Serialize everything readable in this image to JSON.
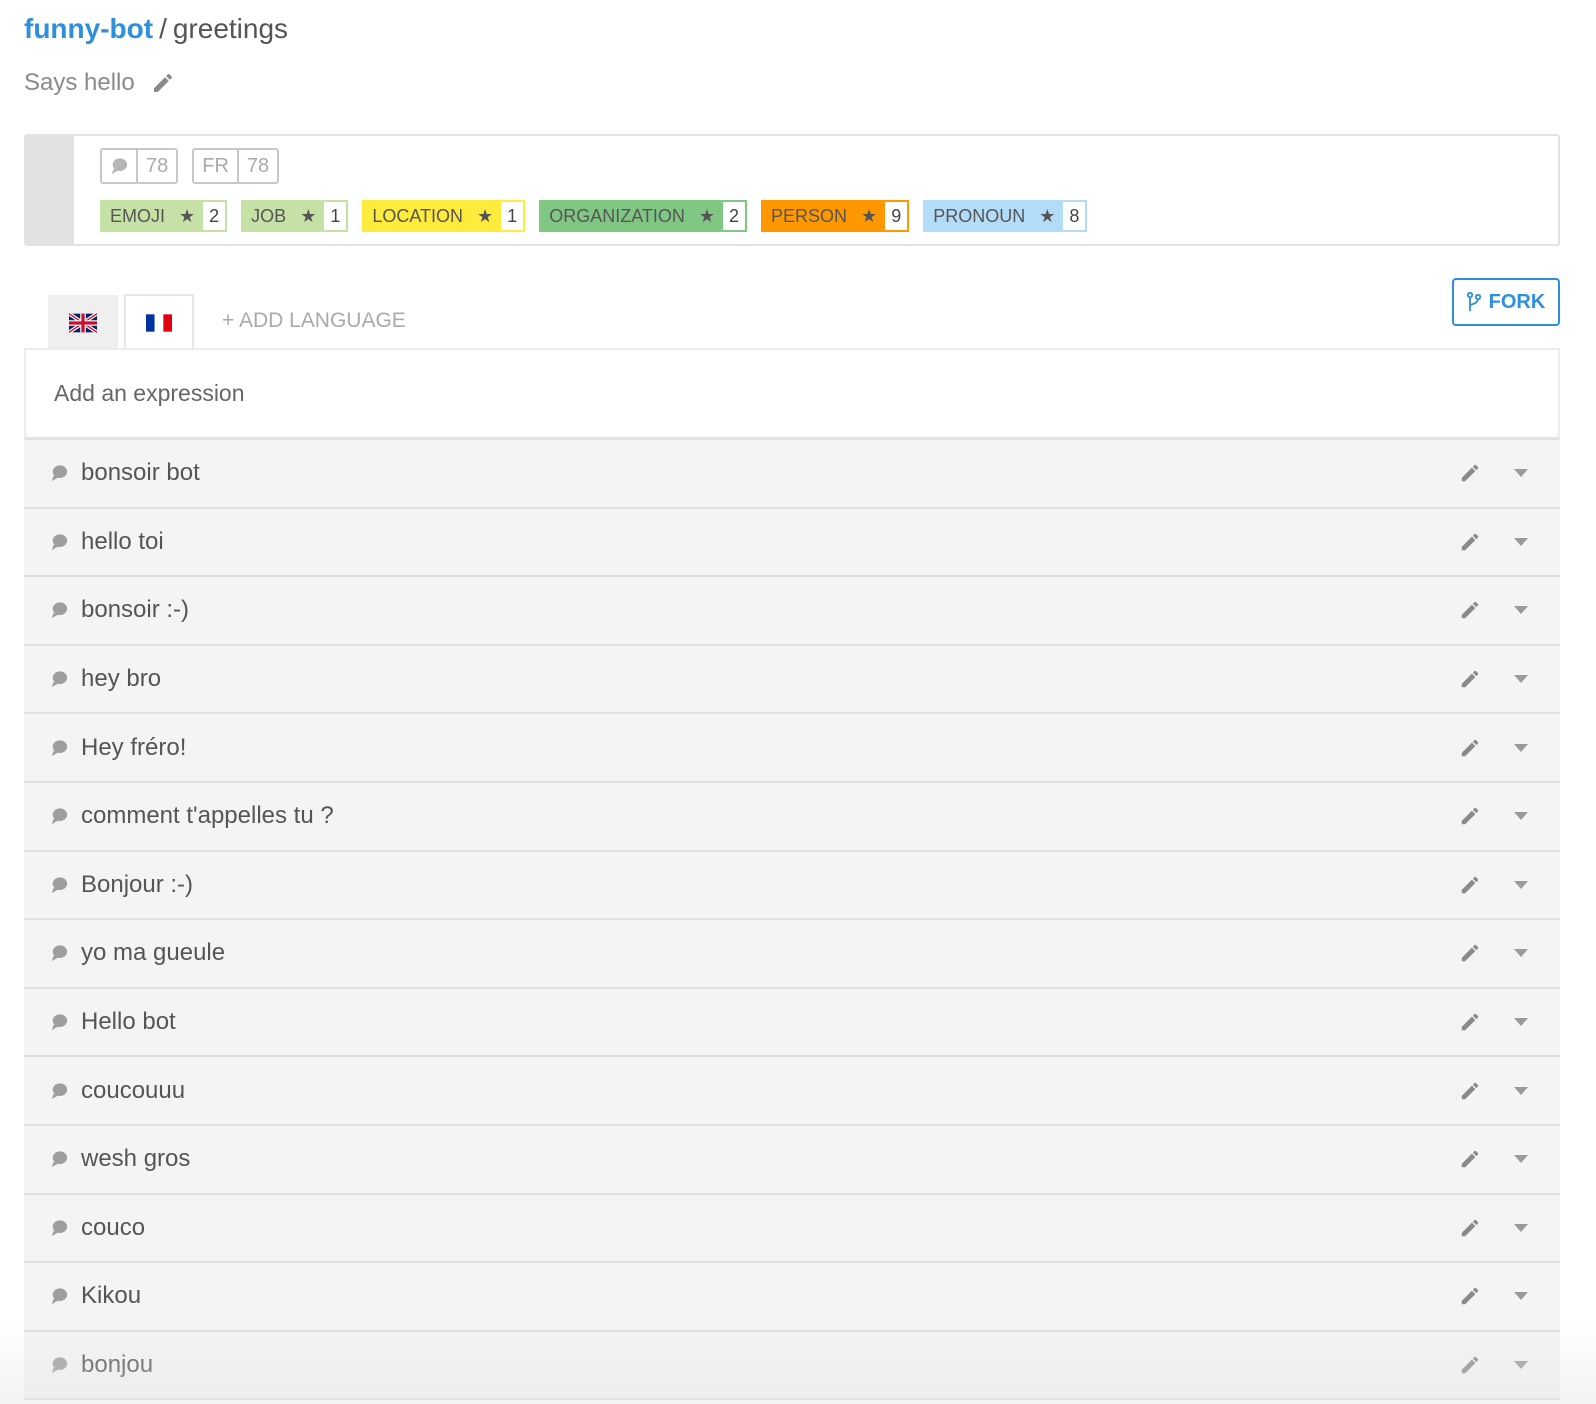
{
  "breadcrumb": {
    "bot": "funny-bot",
    "separator": "/",
    "intent": "greetings"
  },
  "description": "Says hello",
  "counters": [
    {
      "icon": "speech-bubble-icon",
      "value": "78"
    },
    {
      "label": "FR",
      "value": "78"
    }
  ],
  "entities": [
    {
      "name": "EMOJI",
      "count": "2",
      "color": "#c5e1a5",
      "border": "#c5e1a5"
    },
    {
      "name": "JOB",
      "count": "1",
      "color": "#c5e1a5",
      "border": "#c5e1a5"
    },
    {
      "name": "LOCATION",
      "count": "1",
      "color": "#ffeb3b",
      "border": "#ffeb3b"
    },
    {
      "name": "ORGANIZATION",
      "count": "2",
      "color": "#81c784",
      "border": "#81c784"
    },
    {
      "name": "PERSON",
      "count": "9",
      "color": "#ff9800",
      "border": "#ff9800"
    },
    {
      "name": "PRONOUN",
      "count": "8",
      "color": "#b3dcf9",
      "border": "#b3dcf9"
    }
  ],
  "tabs": {
    "en": "en-flag-icon",
    "fr": "fr-flag-icon",
    "add_language": "+ ADD LANGUAGE"
  },
  "fork_label": "FORK",
  "add_expression_placeholder": "Add an expression",
  "expressions": [
    "bonsoir bot",
    "hello toi",
    "bonsoir :-)",
    "hey bro",
    "Hey fréro!",
    "comment t'appelles tu ?",
    "Bonjour :-)",
    "yo ma gueule",
    "Hello bot",
    "coucouuu",
    "wesh gros",
    "couco",
    "Kikou",
    "bonjou"
  ],
  "colors": {
    "accent": "#2d8fde",
    "row_bg": "#f4f4f4"
  }
}
